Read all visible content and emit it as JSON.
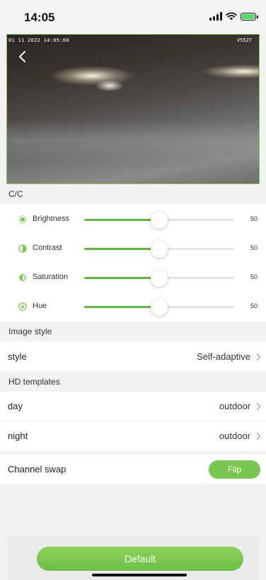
{
  "status_bar": {
    "time": "14:05"
  },
  "video": {
    "osd_timestamp": "01 11 2022 14:05:00",
    "osd_channel": "V5527"
  },
  "cc": {
    "header": "C/C",
    "sliders": [
      {
        "label": "Brightness",
        "value": "50",
        "icon": "sun-icon"
      },
      {
        "label": "Contrast",
        "value": "50",
        "icon": "contrast-icon"
      },
      {
        "label": "Saturation",
        "value": "50",
        "icon": "saturation-icon"
      },
      {
        "label": "Hue",
        "value": "50",
        "icon": "hue-icon"
      }
    ],
    "level_fraction": 0.5
  },
  "image_style": {
    "header": "Image style",
    "style_label": "style",
    "style_value": "Self-adaptive"
  },
  "hd_templates": {
    "header": "HD templates",
    "day_label": "day",
    "day_value": "outdoor",
    "night_label": "night",
    "night_value": "outdoor"
  },
  "channel_swap": {
    "label": "Channel swap",
    "button": "Flip"
  },
  "footer": {
    "default_button": "Default"
  },
  "colors": {
    "accent": "#5cb73a",
    "button_green": "#79c64e",
    "background": "#f2f2f2"
  }
}
